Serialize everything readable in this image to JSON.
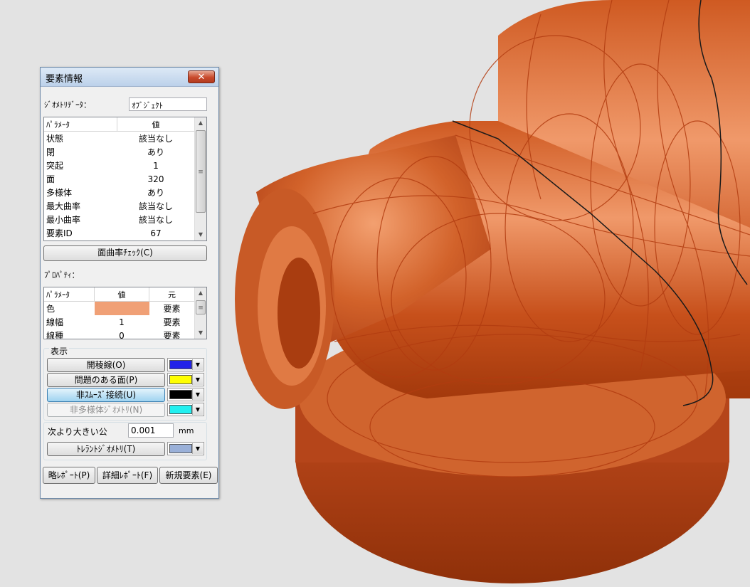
{
  "viewport": {
    "background_color": "#e3e3e3",
    "model_color": "#c5521c",
    "edge_color": "#b23c10"
  },
  "dialog": {
    "title": "要素情報",
    "close_label": "✕",
    "geometry_data_label": "ｼﾞｵﾒﾄﾘﾃﾞｰﾀ：",
    "geometry_data_value": "ｵﾌﾞｼﾞｪｸﾄ",
    "param_table": {
      "headers": [
        "ﾊﾟﾗﾒｰﾀ",
        "値"
      ],
      "rows": [
        [
          "状態",
          "該当なし"
        ],
        [
          "閉",
          "あり"
        ],
        [
          "突起",
          "1"
        ],
        [
          "面",
          "320"
        ],
        [
          "多様体",
          "あり"
        ],
        [
          "最大曲率",
          "該当なし"
        ],
        [
          "最小曲率",
          "該当なし"
        ],
        [
          "要素ID",
          "67"
        ]
      ]
    },
    "curvature_check_label": "面曲率ﾁｪｯｸ(C)",
    "property_label": "ﾌﾟﾛﾊﾟﾃｨ：",
    "prop_table": {
      "headers": [
        "ﾊﾟﾗﾒｰﾀ",
        "値",
        "元"
      ],
      "rows": [
        {
          "name": "色",
          "value": "",
          "swatch": "#f0a076",
          "source": "要素"
        },
        {
          "name": "線幅",
          "value": "1",
          "source": "要素"
        },
        {
          "name": "線種",
          "value": "0",
          "source": "要素"
        }
      ]
    },
    "display": {
      "group_label": "表示",
      "items": [
        {
          "label": "開稜線(O)",
          "color": "#2222e8",
          "state": "normal"
        },
        {
          "label": "問題のある面(P)",
          "color": "#ffff00",
          "state": "normal"
        },
        {
          "label": "非ｽﾑｰｽﾞ接続(U)",
          "color": "#000000",
          "state": "active"
        },
        {
          "label": "非多様体ｼﾞｵﾒﾄﾘ(N)",
          "color": "#22f0f0",
          "state": "disabled"
        }
      ]
    },
    "tolerance": {
      "label": "次より大きい公",
      "value": "0.001",
      "unit": "mm",
      "button_label": "ﾄﾚﾗﾝﾄｼﾞｵﾒﾄﾘ(T)",
      "color": "#9ab0d8"
    },
    "footer": {
      "brief_report": "略ﾚﾎﾟｰﾄ(P)",
      "detail_report": "詳細ﾚﾎﾟｰﾄ(F)",
      "new_element": "新規要素(E)"
    }
  }
}
